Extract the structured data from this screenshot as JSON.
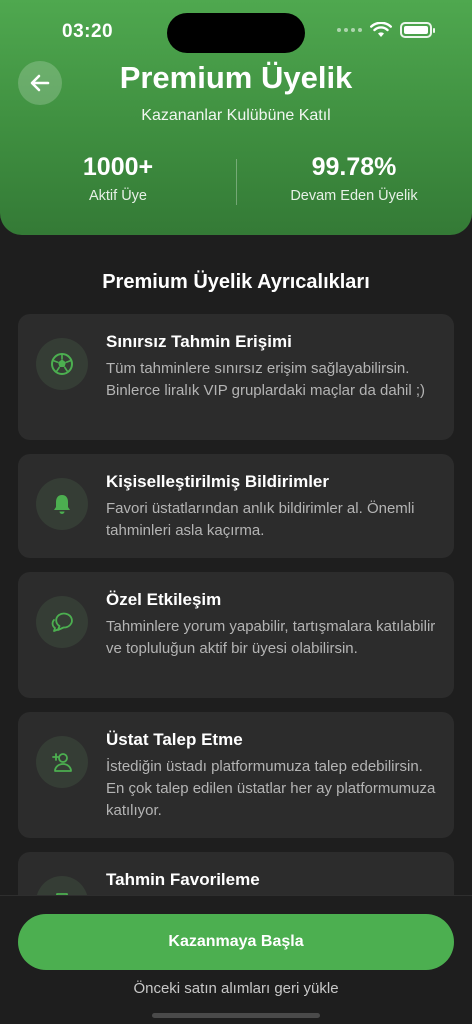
{
  "status_bar": {
    "time": "03:20"
  },
  "header": {
    "title": "Premium Üyelik",
    "subtitle": "Kazananlar Kulübüne Katıl",
    "stats": [
      {
        "value": "1000+",
        "label": "Aktif Üye"
      },
      {
        "value": "99.78%",
        "label": "Devam Eden Üyelik"
      }
    ]
  },
  "section": {
    "title": "Premium Üyelik Ayrıcalıkları",
    "features": [
      {
        "icon": "soccer-ball-icon",
        "title": "Sınırsız Tahmin Erişimi",
        "description": "Tüm tahminlere sınırsız erişim sağlayabilirsin. Binlerce liralık VIP gruplardaki maçlar da dahil ;)"
      },
      {
        "icon": "bell-icon",
        "title": "Kişiselleştirilmiş Bildirimler",
        "description": "Favori üstatlarından anlık bildirimler al. Önemli tahminleri asla kaçırma."
      },
      {
        "icon": "chat-bubbles-icon",
        "title": "Özel Etkileşim",
        "description": "Tahminlere yorum yapabilir, tartışmalara katılabilir ve topluluğun aktif bir üyesi olabilirsin."
      },
      {
        "icon": "person-add-icon",
        "title": "Üstat Talep Etme",
        "description": "İstediğin üstadı platformumuza talep edebilirsin. En çok talep edilen üstatlar her ay platformumuza katılıyor."
      },
      {
        "icon": "bookmark-icon",
        "title": "Tahmin Favorileme",
        "description": ""
      }
    ]
  },
  "footer": {
    "cta_label": "Kazanmaya Başla",
    "restore_label": "Önceki satın alımları geri yükle"
  },
  "colors": {
    "accent": "#4caf50",
    "header": "#3f8f40",
    "background": "#1e1e1e",
    "card": "#2c2c2c"
  }
}
